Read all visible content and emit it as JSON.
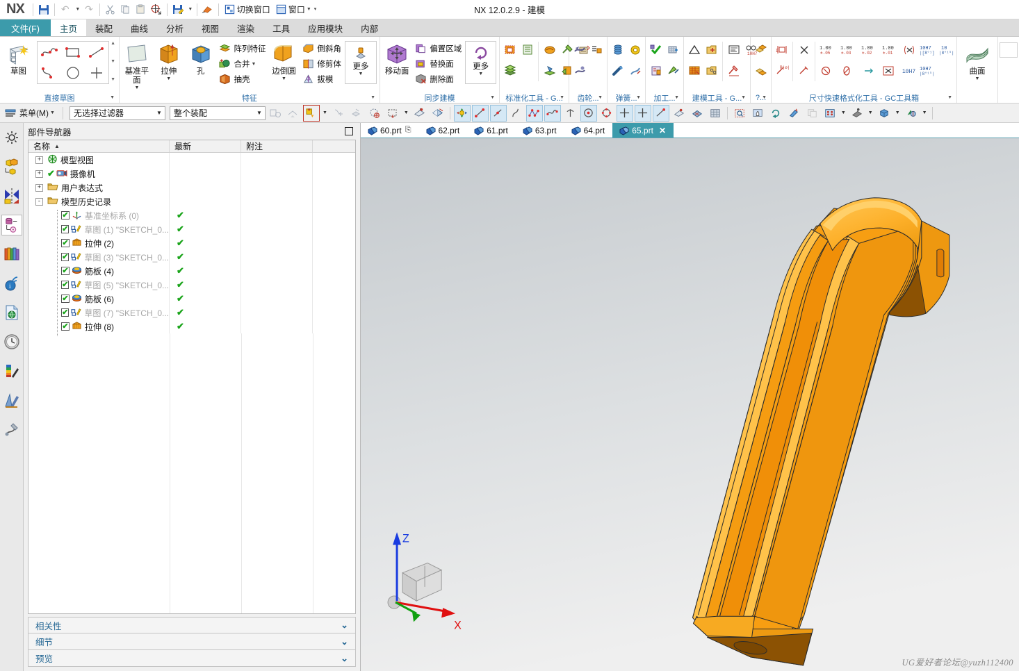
{
  "window": {
    "app_name": "NX",
    "title": "NX 12.0.2.9 - 建模"
  },
  "quick_access": {
    "items": [
      {
        "name": "save-icon",
        "label": ""
      },
      {
        "name": "undo-icon",
        "label": ""
      },
      {
        "name": "redo-icon",
        "label": ""
      },
      {
        "name": "cut-icon",
        "label": ""
      },
      {
        "name": "copy-icon",
        "label": ""
      },
      {
        "name": "paste-icon",
        "label": ""
      },
      {
        "name": "snapshot-icon",
        "label": ""
      },
      {
        "name": "save-as-icon",
        "label": ""
      },
      {
        "name": "eraser-icon",
        "label": ""
      }
    ],
    "switch_window_label": "切换窗口",
    "window_label": "窗口"
  },
  "ribbon": {
    "tabs": [
      {
        "label": "文件(F)",
        "kind": "file"
      },
      {
        "label": "主页",
        "kind": "active"
      },
      {
        "label": "装配",
        "kind": "normal"
      },
      {
        "label": "曲线",
        "kind": "normal"
      },
      {
        "label": "分析",
        "kind": "normal"
      },
      {
        "label": "视图",
        "kind": "normal"
      },
      {
        "label": "渲染",
        "kind": "normal"
      },
      {
        "label": "工具",
        "kind": "normal"
      },
      {
        "label": "应用模块",
        "kind": "normal"
      },
      {
        "label": "内部",
        "kind": "normal"
      }
    ],
    "groups": [
      {
        "id": "direct-sketch",
        "title": "直接草图",
        "big_buttons": [
          {
            "label": "草图",
            "icon": "sketch-icon"
          }
        ],
        "gallery_icons": [
          "spline-icon",
          "rectangle-icon",
          "line-icon",
          "arc-icon",
          "circle-icon",
          "point-icon"
        ]
      },
      {
        "id": "feature",
        "title": "特征",
        "big_buttons": [
          {
            "label": "基准平面",
            "icon": "datum-plane-icon",
            "has_caret": true
          },
          {
            "label": "拉伸",
            "icon": "extrude-icon",
            "has_caret": true
          },
          {
            "label": "孔",
            "icon": "hole-icon",
            "has_caret": false
          },
          {
            "label": "边倒圆",
            "icon": "edge-blend-icon",
            "has_caret": true
          },
          {
            "label": "更多",
            "icon": "more-icon",
            "has_caret": true
          }
        ],
        "small_buttons_a": [
          {
            "label": "阵列特征",
            "icon": "pattern-feature-icon"
          },
          {
            "label": "合并",
            "icon": "unite-icon",
            "has_caret": true
          },
          {
            "label": "抽壳",
            "icon": "shell-icon"
          }
        ],
        "small_buttons_b": [
          {
            "label": "倒斜角",
            "icon": "chamfer-icon"
          },
          {
            "label": "修剪体",
            "icon": "trim-body-icon"
          },
          {
            "label": "拔模",
            "icon": "draft-icon"
          }
        ]
      },
      {
        "id": "synchronous",
        "title": "同步建模",
        "big_buttons": [
          {
            "label": "移动面",
            "icon": "move-face-icon",
            "has_caret": false
          },
          {
            "label": "更多",
            "icon": "more-sync-icon",
            "has_caret": true
          }
        ],
        "small_buttons_a": [
          {
            "label": "偏置区域",
            "icon": "offset-region-icon"
          },
          {
            "label": "替换面",
            "icon": "replace-face-icon"
          },
          {
            "label": "删除面",
            "icon": "delete-face-icon"
          }
        ]
      },
      {
        "id": "standardize",
        "title": "标准化工具 - G...",
        "icon_count": 8
      },
      {
        "id": "gear",
        "title": "齿轮...",
        "icon_count": 3
      },
      {
        "id": "spring",
        "title": "弹簧...",
        "icon_count": 4
      },
      {
        "id": "machining",
        "title": "加工...",
        "icon_count": 4
      },
      {
        "id": "modeling-tools",
        "title": "建模工具 - G...",
        "icon_count": 7
      },
      {
        "id": "extra",
        "title": "?...",
        "icon_count": 2
      },
      {
        "id": "dim-format",
        "title": "尺寸快速格式化工具 - GC工具箱",
        "icon_count": 18
      },
      {
        "id": "surface",
        "title": "",
        "big_buttons": [
          {
            "label": "曲面",
            "icon": "surface-icon",
            "has_caret": true
          }
        ]
      }
    ]
  },
  "selection_bar": {
    "menu_label": "菜单(M)",
    "filter_value": "无选择过滤器",
    "scope_value": "整个装配",
    "buttons": [
      {
        "name": "select-general-icon",
        "state": "disabled"
      },
      {
        "name": "select-feature-icon",
        "state": "disabled"
      },
      {
        "name": "snap-point-icon",
        "state": "highlight"
      },
      {
        "name": "snap-caret",
        "state": "caret"
      },
      {
        "name": "point-constructor-icon",
        "state": "disabled"
      },
      {
        "name": "select-face-icon",
        "state": "disabled"
      },
      {
        "name": "select-region-icon",
        "state": "normal"
      },
      {
        "name": "rectangle-select-icon",
        "state": "normal"
      },
      {
        "name": "rect-caret",
        "state": "caret"
      },
      {
        "name": "show-hide-icon",
        "state": "normal"
      },
      {
        "name": "immediate-hide-icon",
        "state": "normal"
      },
      {
        "name": "move-object-icon",
        "state": "selected"
      },
      {
        "name": "line-icon",
        "state": "selected"
      },
      {
        "name": "line2-icon",
        "state": "selected"
      },
      {
        "name": "spline-icon",
        "state": "normal"
      },
      {
        "name": "studio-spline-icon",
        "state": "selected"
      },
      {
        "name": "wave-icon",
        "state": "selected"
      },
      {
        "name": "intersection-icon",
        "state": "normal"
      },
      {
        "name": "circle-center-icon",
        "state": "selected"
      },
      {
        "name": "arc-center-icon",
        "state": "normal"
      },
      {
        "name": "point-icon",
        "state": "selected"
      },
      {
        "name": "midpoint-icon",
        "state": "selected"
      },
      {
        "name": "quadrant-icon",
        "state": "selected"
      },
      {
        "name": "face-snap-icon",
        "state": "normal"
      },
      {
        "name": "mesh-icon",
        "state": "normal"
      },
      {
        "name": "grid-icon",
        "state": "normal"
      },
      {
        "name": "fit-view-icon",
        "state": "normal"
      },
      {
        "name": "pan-icon",
        "state": "normal"
      },
      {
        "name": "rotate-icon",
        "state": "normal"
      },
      {
        "name": "zoom-icon",
        "state": "normal"
      },
      {
        "name": "section-icon",
        "state": "disabled"
      },
      {
        "name": "view-layout-icon",
        "state": "normal"
      },
      {
        "name": "layout-caret",
        "state": "caret"
      },
      {
        "name": "render-style-icon",
        "state": "normal"
      },
      {
        "name": "render-caret",
        "state": "caret"
      },
      {
        "name": "orientation-icon",
        "state": "normal"
      },
      {
        "name": "orient-caret",
        "state": "caret"
      },
      {
        "name": "visual-icon",
        "state": "normal"
      },
      {
        "name": "visual-caret",
        "state": "caret"
      }
    ]
  },
  "rail": {
    "items": [
      {
        "name": "rail-assembly-navigator-icon",
        "active": false
      },
      {
        "name": "rail-part-navigator-icon",
        "active": false
      },
      {
        "name": "rail-constraint-navigator-icon",
        "active": false
      },
      {
        "name": "rail-feature-navigator-icon",
        "active": true
      },
      {
        "name": "rail-reuse-library-icon",
        "active": false
      },
      {
        "name": "rail-hd3d-icon",
        "active": false
      },
      {
        "name": "rail-web-browser-icon",
        "active": false
      },
      {
        "name": "rail-history-icon",
        "active": false
      },
      {
        "name": "rail-system-materials-icon",
        "active": false
      },
      {
        "name": "rail-system-scenes-icon",
        "active": false
      },
      {
        "name": "rail-process-studio-icon",
        "active": false
      }
    ]
  },
  "part_navigator": {
    "title": "部件导航器",
    "columns": [
      "名称",
      "最新",
      "附注"
    ],
    "rows": [
      {
        "indent": 0,
        "expander": "+",
        "check": false,
        "icon": "model-views-icon",
        "label": "模型视图",
        "dim": false,
        "latest": ""
      },
      {
        "indent": 0,
        "expander": "+",
        "check": false,
        "precheck": true,
        "icon": "camera-icon",
        "label": "摄像机",
        "dim": false,
        "latest": ""
      },
      {
        "indent": 0,
        "expander": "+",
        "check": false,
        "icon": "folder-icon",
        "label": "用户表达式",
        "dim": false,
        "latest": ""
      },
      {
        "indent": 0,
        "expander": "-",
        "check": false,
        "icon": "folder-icon",
        "label": "模型历史记录",
        "dim": false,
        "latest": ""
      },
      {
        "indent": 1,
        "expander": "",
        "check": true,
        "icon": "datum-csys-icon",
        "label": "基准坐标系 (0)",
        "dim": true,
        "latest": "✔"
      },
      {
        "indent": 1,
        "expander": "",
        "check": true,
        "icon": "sketch-icon",
        "label": "草图 (1) \"SKETCH_0...",
        "dim": true,
        "latest": "✔"
      },
      {
        "indent": 1,
        "expander": "",
        "check": true,
        "icon": "extrude-icon",
        "label": "拉伸 (2)",
        "dim": false,
        "latest": "✔"
      },
      {
        "indent": 1,
        "expander": "",
        "check": true,
        "icon": "sketch-icon",
        "label": "草图 (3) \"SKETCH_0...",
        "dim": true,
        "latest": "✔"
      },
      {
        "indent": 1,
        "expander": "",
        "check": true,
        "icon": "rib-icon",
        "label": "筋板 (4)",
        "dim": false,
        "latest": "✔"
      },
      {
        "indent": 1,
        "expander": "",
        "check": true,
        "icon": "sketch-icon",
        "label": "草图 (5) \"SKETCH_0...",
        "dim": true,
        "latest": "✔"
      },
      {
        "indent": 1,
        "expander": "",
        "check": true,
        "icon": "rib-icon",
        "label": "筋板 (6)",
        "dim": false,
        "latest": "✔"
      },
      {
        "indent": 1,
        "expander": "",
        "check": true,
        "icon": "sketch-icon",
        "label": "草图 (7) \"SKETCH_0...",
        "dim": true,
        "latest": "✔"
      },
      {
        "indent": 1,
        "expander": "",
        "check": true,
        "icon": "extrude-icon",
        "label": "拉伸 (8)",
        "dim": false,
        "latest": "✔"
      }
    ],
    "sections": [
      {
        "label": "相关性",
        "chevron": "⌄"
      },
      {
        "label": "细节",
        "chevron": "⌄"
      },
      {
        "label": "预览",
        "chevron": "⌄"
      }
    ]
  },
  "document_tabs": [
    {
      "label": "60.prt",
      "active": false,
      "has_marker": true
    },
    {
      "label": "62.prt",
      "active": false,
      "has_marker": false
    },
    {
      "label": "61.prt",
      "active": false,
      "has_marker": false
    },
    {
      "label": "63.prt",
      "active": false,
      "has_marker": false
    },
    {
      "label": "64.prt",
      "active": false,
      "has_marker": false
    },
    {
      "label": "65.prt",
      "active": true,
      "has_marker": false,
      "close": "✕"
    }
  ],
  "viewport": {
    "watermark": "UG爱好者论坛@yuzh112400",
    "triad": {
      "z_label": "Z",
      "x_label": "X"
    },
    "model_color_light": "#FFB733",
    "model_color_mid": "#F79C12",
    "model_color_dark": "#E08A0A",
    "background_top": "#c9cdd0",
    "background_bottom": "#efefef"
  }
}
